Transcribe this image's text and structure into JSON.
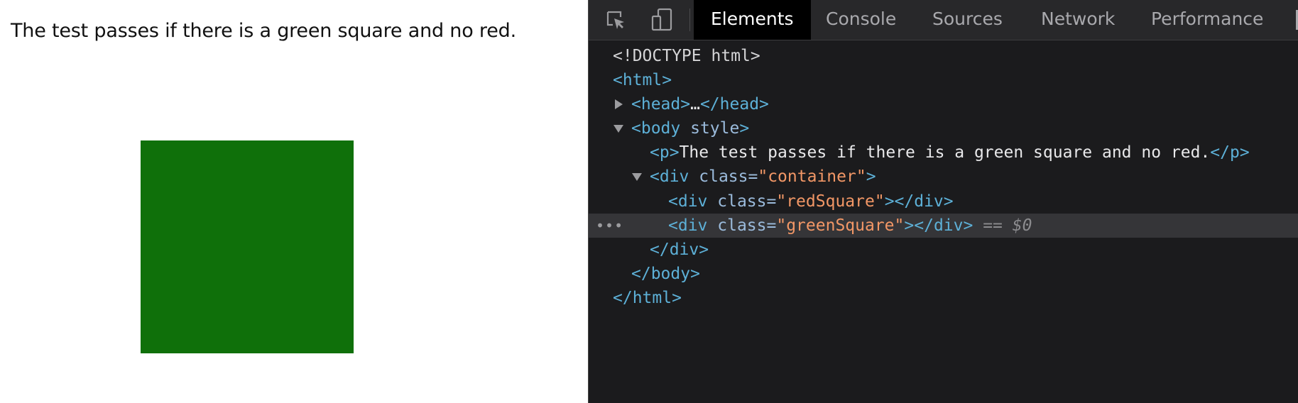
{
  "page": {
    "test_text": "The test passes if there is a green square and no red.",
    "square_color": "#0f700a"
  },
  "devtools": {
    "tools": {
      "inspect_icon": "inspect-element-icon",
      "device_icon": "device-toolbar-icon"
    },
    "tabs": [
      "Elements",
      "Console",
      "Sources",
      "Network",
      "Performance"
    ],
    "active_tab": "Elements",
    "dom": {
      "doctype": "<!DOCTYPE html>",
      "html_open": "<html>",
      "head_open": "<head>",
      "head_ellipsis": "…",
      "head_close": "</head>",
      "body_open_tag": "<body",
      "body_attr": "style",
      "body_open_end": ">",
      "p_open": "<p>",
      "p_text": "The test passes if there is a green square and no red.",
      "p_close": "</p>",
      "div_open_tag": "<div",
      "class_attr": "class=",
      "quote": "\"",
      "container_class": "container",
      "tag_end": ">",
      "red_class": "redSquare",
      "green_class": "greenSquare",
      "div_close": "</div>",
      "selected_marker": "== $0",
      "row_dots": "•••",
      "body_close": "</body>",
      "html_close": "</html>"
    }
  }
}
